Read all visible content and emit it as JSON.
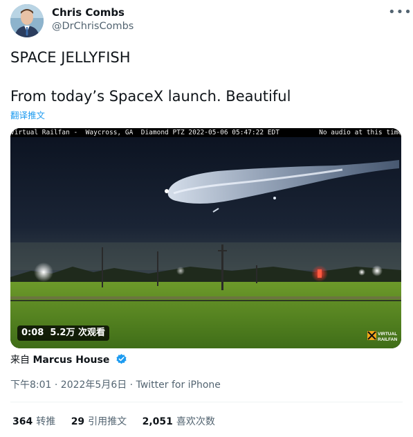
{
  "author": {
    "name": "Chris Combs",
    "handle": "@DrChrisCombs"
  },
  "tweet": {
    "line1": "SPACE JELLYFISH",
    "line2": "From today’s SpaceX launch. Beautiful",
    "translate_label": "翻译推文"
  },
  "video": {
    "overlay_text": "Virtual Railfan -  Waycross, GA  Diamond PTZ 2022-05-06 05:47:22 EDT          No audio at this time",
    "duration": "0:08",
    "views": "5.2万 次观看",
    "watermark": "VIRTUAL RAILFAN"
  },
  "source": {
    "prefix": "来自",
    "name": "Marcus House"
  },
  "meta": {
    "text": "下午8:01 · 2022年5月6日 · Twitter for iPhone"
  },
  "stats": [
    {
      "count": "364",
      "label": "转推"
    },
    {
      "count": "29",
      "label": "引用推文"
    },
    {
      "count": "2,051",
      "label": "喜欢次数"
    }
  ],
  "icons": {
    "more": "more-dots-icon",
    "verified": "verified-badge-icon"
  },
  "colors": {
    "link": "#1d9bf0",
    "secondary_text": "#536471"
  }
}
